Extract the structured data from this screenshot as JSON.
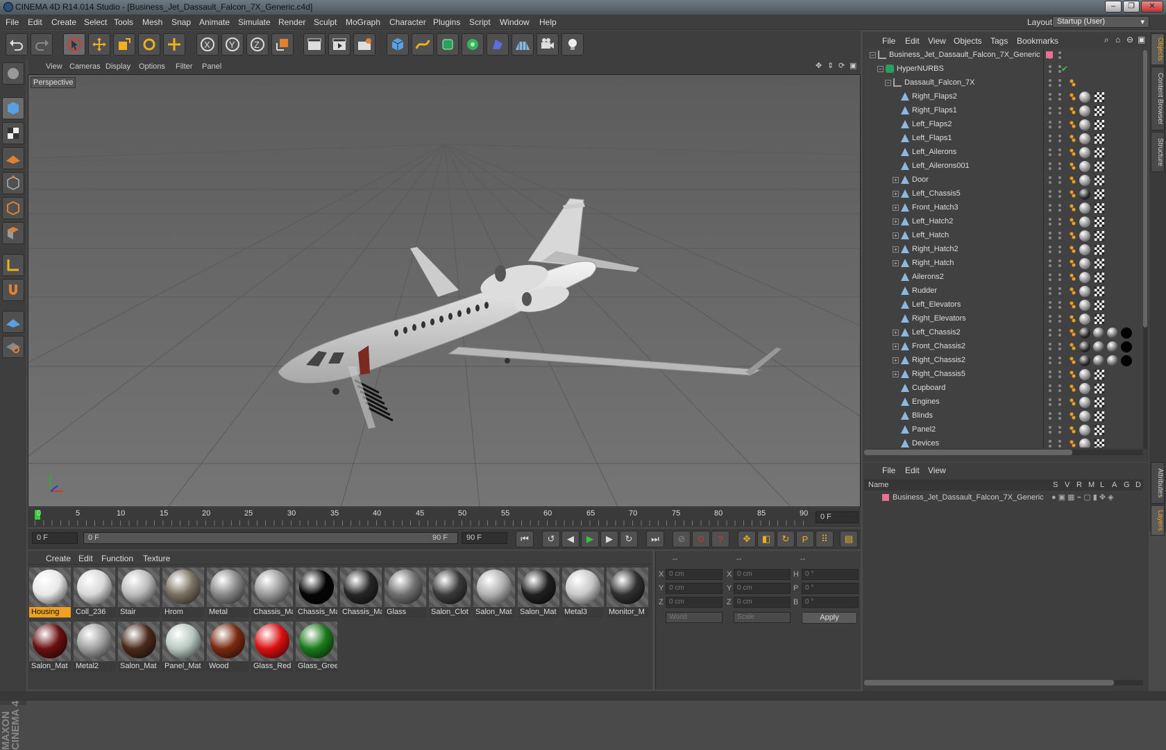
{
  "window": {
    "title": "CINEMA 4D R14.014 Studio - [Business_Jet_Dassault_Falcon_7X_Generic.c4d]"
  },
  "menu": [
    "File",
    "Edit",
    "Create",
    "Select",
    "Tools",
    "Mesh",
    "Snap",
    "Animate",
    "Simulate",
    "Render",
    "Sculpt",
    "MoGraph",
    "Character",
    "Plugins",
    "Script",
    "Window",
    "Help"
  ],
  "layout": {
    "label": "Layout:",
    "value": "Startup (User)"
  },
  "viewport": {
    "menu": [
      "View",
      "Cameras",
      "Display",
      "Options",
      "Filter",
      "Panel"
    ],
    "label": "Perspective"
  },
  "timeline": {
    "ticks": [
      "0",
      "5",
      "10",
      "15",
      "20",
      "25",
      "30",
      "35",
      "40",
      "45",
      "50",
      "55",
      "60",
      "65",
      "70",
      "75",
      "80",
      "85",
      "90"
    ],
    "current": "0 F"
  },
  "transport": {
    "start": "0 F",
    "range_start": "0 F",
    "range_end": "90 F",
    "end": "90 F"
  },
  "materials": {
    "menu": [
      "Create",
      "Edit",
      "Function",
      "Texture"
    ],
    "items": [
      {
        "name": "Housing",
        "color": "#e8e8e8"
      },
      {
        "name": "Coll_236",
        "color": "#d8d8d8"
      },
      {
        "name": "Stair",
        "color": "#bbbbbb"
      },
      {
        "name": "Hrom",
        "color": "#7a7060"
      },
      {
        "name": "Metal",
        "color": "#888888"
      },
      {
        "name": "Chassis_Ma",
        "color": "#999999"
      },
      {
        "name": "Chassis_Ma",
        "color": "#050505"
      },
      {
        "name": "Chassis_Ma",
        "color": "#262626"
      },
      {
        "name": "Glass",
        "color": "#707070"
      },
      {
        "name": "Salon_Clot",
        "color": "#3a3a3a"
      },
      {
        "name": "Salon_Mat",
        "color": "#b0b0b0"
      },
      {
        "name": "Salon_Mat",
        "color": "#202020"
      },
      {
        "name": "Metal3",
        "color": "#c8c8c8"
      },
      {
        "name": "Monitor_M",
        "color": "#303030"
      },
      {
        "name": "Salon_Mat",
        "color": "#6a1010"
      },
      {
        "name": "Metal2",
        "color": "#a0a0a0"
      },
      {
        "name": "Salon_Mat",
        "color": "#4a2a1a"
      },
      {
        "name": "Panel_Mat",
        "color": "#b8c8c0"
      },
      {
        "name": "Wood",
        "color": "#7a2a10"
      },
      {
        "name": "Glass_Red",
        "color": "#dd1010"
      },
      {
        "name": "Glass_Gree",
        "color": "#1a7a1a"
      }
    ]
  },
  "coords": {
    "headers": [
      "--",
      "--",
      "--"
    ],
    "rows": [
      {
        "a": "X",
        "av": "0 cm",
        "b": "X",
        "bv": "0 cm",
        "c": "H",
        "cv": "0 °"
      },
      {
        "a": "Y",
        "av": "0 cm",
        "b": "Y",
        "bv": "0 cm",
        "c": "P",
        "cv": "0 °"
      },
      {
        "a": "Z",
        "av": "0 cm",
        "b": "Z",
        "bv": "0 cm",
        "c": "B",
        "cv": "0 °"
      }
    ],
    "world": "World",
    "scale": "Scale",
    "apply": "Apply"
  },
  "objects": {
    "menu": [
      "File",
      "Edit",
      "View",
      "Objects",
      "Tags",
      "Bookmarks"
    ],
    "items": [
      {
        "name": "Business_Jet_Dassault_Falcon_7X_Generic",
        "level": 0
      },
      {
        "name": "HyperNURBS",
        "level": 1
      },
      {
        "name": "Dassault_Falcon_7X",
        "level": 2
      },
      {
        "name": "Right_Flaps2",
        "level": 3
      },
      {
        "name": "Right_Flaps1",
        "level": 3
      },
      {
        "name": "Left_Flaps2",
        "level": 3
      },
      {
        "name": "Left_Flaps1",
        "level": 3
      },
      {
        "name": "Left_Ailerons",
        "level": 3
      },
      {
        "name": "Left_Ailerons001",
        "level": 3
      },
      {
        "name": "Door",
        "level": 3
      },
      {
        "name": "Left_Chassis5",
        "level": 3
      },
      {
        "name": "Front_Hatch3",
        "level": 3
      },
      {
        "name": "Left_Hatch2",
        "level": 3
      },
      {
        "name": "Left_Hatch",
        "level": 3
      },
      {
        "name": "Right_Hatch2",
        "level": 3
      },
      {
        "name": "Right_Hatch",
        "level": 3
      },
      {
        "name": "Ailerons2",
        "level": 3
      },
      {
        "name": "Rudder",
        "level": 3
      },
      {
        "name": "Left_Elevators",
        "level": 3
      },
      {
        "name": "Right_Elevators",
        "level": 3
      },
      {
        "name": "Left_Chassis2",
        "level": 3
      },
      {
        "name": "Front_Chassis2",
        "level": 3
      },
      {
        "name": "Right_Chassis2",
        "level": 3
      },
      {
        "name": "Right_Chassis5",
        "level": 3
      },
      {
        "name": "Cupboard",
        "level": 3
      },
      {
        "name": "Engines",
        "level": 3
      },
      {
        "name": "Blinds",
        "level": 3
      },
      {
        "name": "Panel2",
        "level": 3
      },
      {
        "name": "Devices",
        "level": 3
      }
    ]
  },
  "layers": {
    "menu": [
      "File",
      "Edit",
      "View"
    ],
    "columns": [
      "Name",
      "S",
      "V",
      "R",
      "M",
      "L",
      "A",
      "G",
      "D"
    ],
    "items": [
      "Business_Jet_Dassault_Falcon_7X_Generic"
    ]
  },
  "sidetabs": [
    "Objects",
    "Content Browser",
    "Structure",
    "Attributes",
    "Layers"
  ],
  "brand": "MAXON CINEMA 4D"
}
